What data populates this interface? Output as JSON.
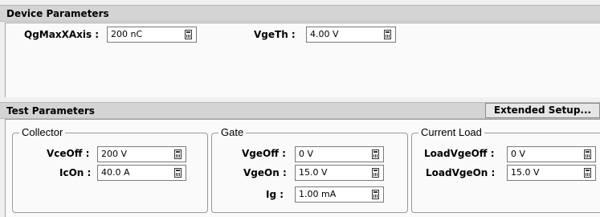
{
  "device": {
    "title": "Device Parameters",
    "qgmax": {
      "label": "QgMaxXAxis :",
      "value": "200 nC"
    },
    "vgeth": {
      "label": "VgeTh :",
      "value": "4.00 V"
    }
  },
  "test": {
    "title": "Test Parameters",
    "extended_label": "Extended Setup...",
    "collector": {
      "title": "Collector",
      "vceoff": {
        "label": "VceOff :",
        "value": "200 V"
      },
      "icon": {
        "label": "IcOn :",
        "value": "40.0 A"
      }
    },
    "gate": {
      "title": "Gate",
      "vgeoff": {
        "label": "VgeOff :",
        "value": "0 V"
      },
      "vgeon": {
        "label": "VgeOn :",
        "value": "15.0 V"
      },
      "ig": {
        "label": "Ig :",
        "value": "1.00 mA"
      }
    },
    "load": {
      "title": "Current Load",
      "loadvgeoff": {
        "label": "LoadVgeOff :",
        "value": "0 V"
      },
      "loadvgeon": {
        "label": "LoadVgeOn :",
        "value": "15.0 V"
      }
    }
  },
  "icons": {
    "calculator": "calculator-icon"
  }
}
